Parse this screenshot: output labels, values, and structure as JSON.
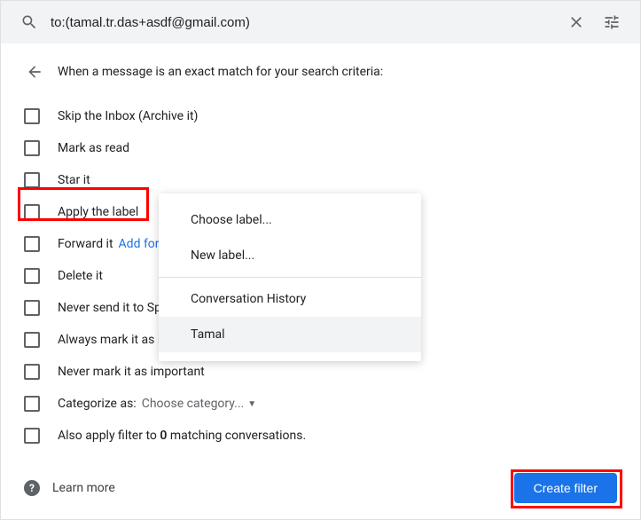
{
  "search": {
    "value": "to:(tamal.tr.das+asdf@gmail.com)"
  },
  "header": {
    "title": "When a message is an exact match for your search criteria:"
  },
  "options": {
    "skip_inbox": "Skip the Inbox (Archive it)",
    "mark_read": "Mark as read",
    "star": "Star it",
    "apply_label": "Apply the label",
    "forward": "Forward it",
    "forward_link": "Add forwarding address",
    "delete": "Delete it",
    "never_spam": "Never send it to Spam",
    "always_important": "Always mark it as important",
    "never_important": "Never mark it as important",
    "categorize": "Categorize as:",
    "category_value": "Choose category...",
    "also_apply_pre": "Also apply filter to ",
    "also_apply_count": "0",
    "also_apply_post": " matching conversations."
  },
  "popup": {
    "choose": "Choose label...",
    "new_label": "New label...",
    "conv_history": "Conversation History",
    "tamal": "Tamal"
  },
  "footer": {
    "learn_more": "Learn more",
    "create": "Create filter"
  }
}
